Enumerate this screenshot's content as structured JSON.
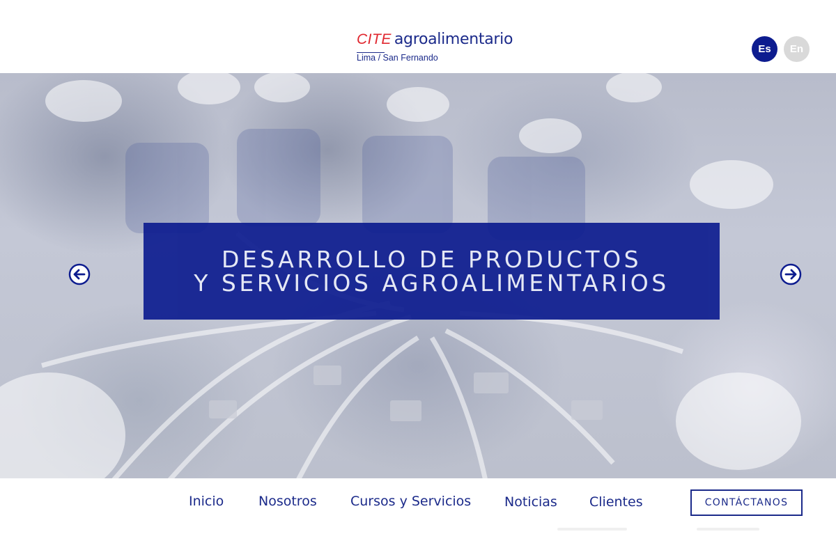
{
  "header": {
    "logo": {
      "cite": "CITE",
      "name": "agroalimentario",
      "subtitle": "Lima / San Fernando"
    },
    "languages": [
      {
        "label": "Es",
        "active": true
      },
      {
        "label": "En",
        "active": false
      }
    ]
  },
  "hero": {
    "banner": {
      "line1": "DESARROLLO DE PRODUCTOS",
      "line2": "Y SERVICIOS AGROALIMENTARIOS"
    },
    "prev_icon": "arrow-left-circle-icon",
    "next_icon": "arrow-right-circle-icon"
  },
  "nav": {
    "items": [
      {
        "label": "Inicio"
      },
      {
        "label": "Nosotros"
      },
      {
        "label": "Cursos y Servicios"
      },
      {
        "label": "Noticias"
      },
      {
        "label": "Clientes"
      }
    ],
    "contact_label": "CONTÁCTANOS"
  },
  "colors": {
    "brand_blue": "#0d1c8f",
    "text_blue": "#1b2a8a",
    "logo_red": "#e0262e",
    "inactive_lang": "#d9d9d9"
  }
}
